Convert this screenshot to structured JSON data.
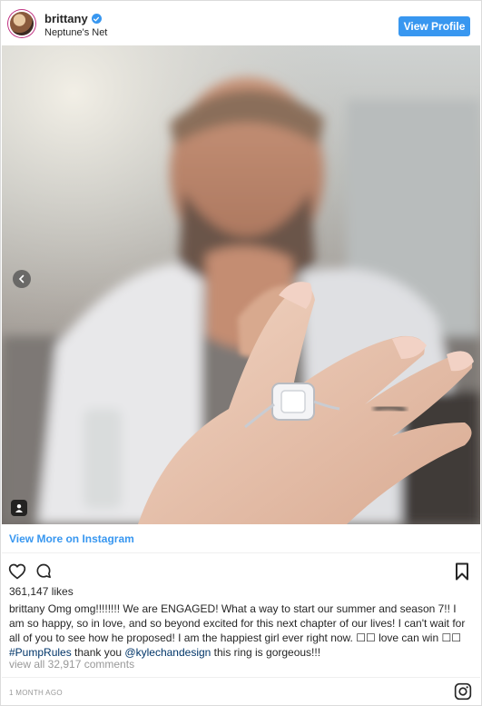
{
  "header": {
    "username": "brittany",
    "location": "Neptune's Net",
    "view_profile_label": "View Profile"
  },
  "post": {
    "view_more_label": "View More on Instagram",
    "likes": "361,147 likes",
    "caption": {
      "user": "brittany",
      "text_part1": " Omg omg!!!!!!!! We are ENGAGED! What a way to start our summer and season 7!! I am so happy, so in love, and so beyond excited for this next chapter of our lives! I can't wait for all of you to see how he proposed! I am the happiest girl ever right now. ",
      "emoji1": "☐☐",
      "text_part2": " love can win ",
      "emoji2": "☐☐",
      "hashtag": "#PumpRules",
      "text_part3": " thank you ",
      "mention": "@kylechandesign",
      "text_part4": " this ring is gorgeous!!!"
    },
    "view_all_comments": "view all 32,917 comments",
    "timestamp": "1 MONTH AGO"
  },
  "icons": {
    "verified": "verified-badge-icon",
    "heart": "heart-icon",
    "comment": "comment-icon",
    "save": "bookmark-icon",
    "prev": "chevron-left-icon",
    "tag": "user-tag-icon",
    "logo": "instagram-logo-icon"
  },
  "colors": {
    "accent": "#3897f0",
    "text": "#262626",
    "muted": "#999999",
    "link": "#003569"
  }
}
